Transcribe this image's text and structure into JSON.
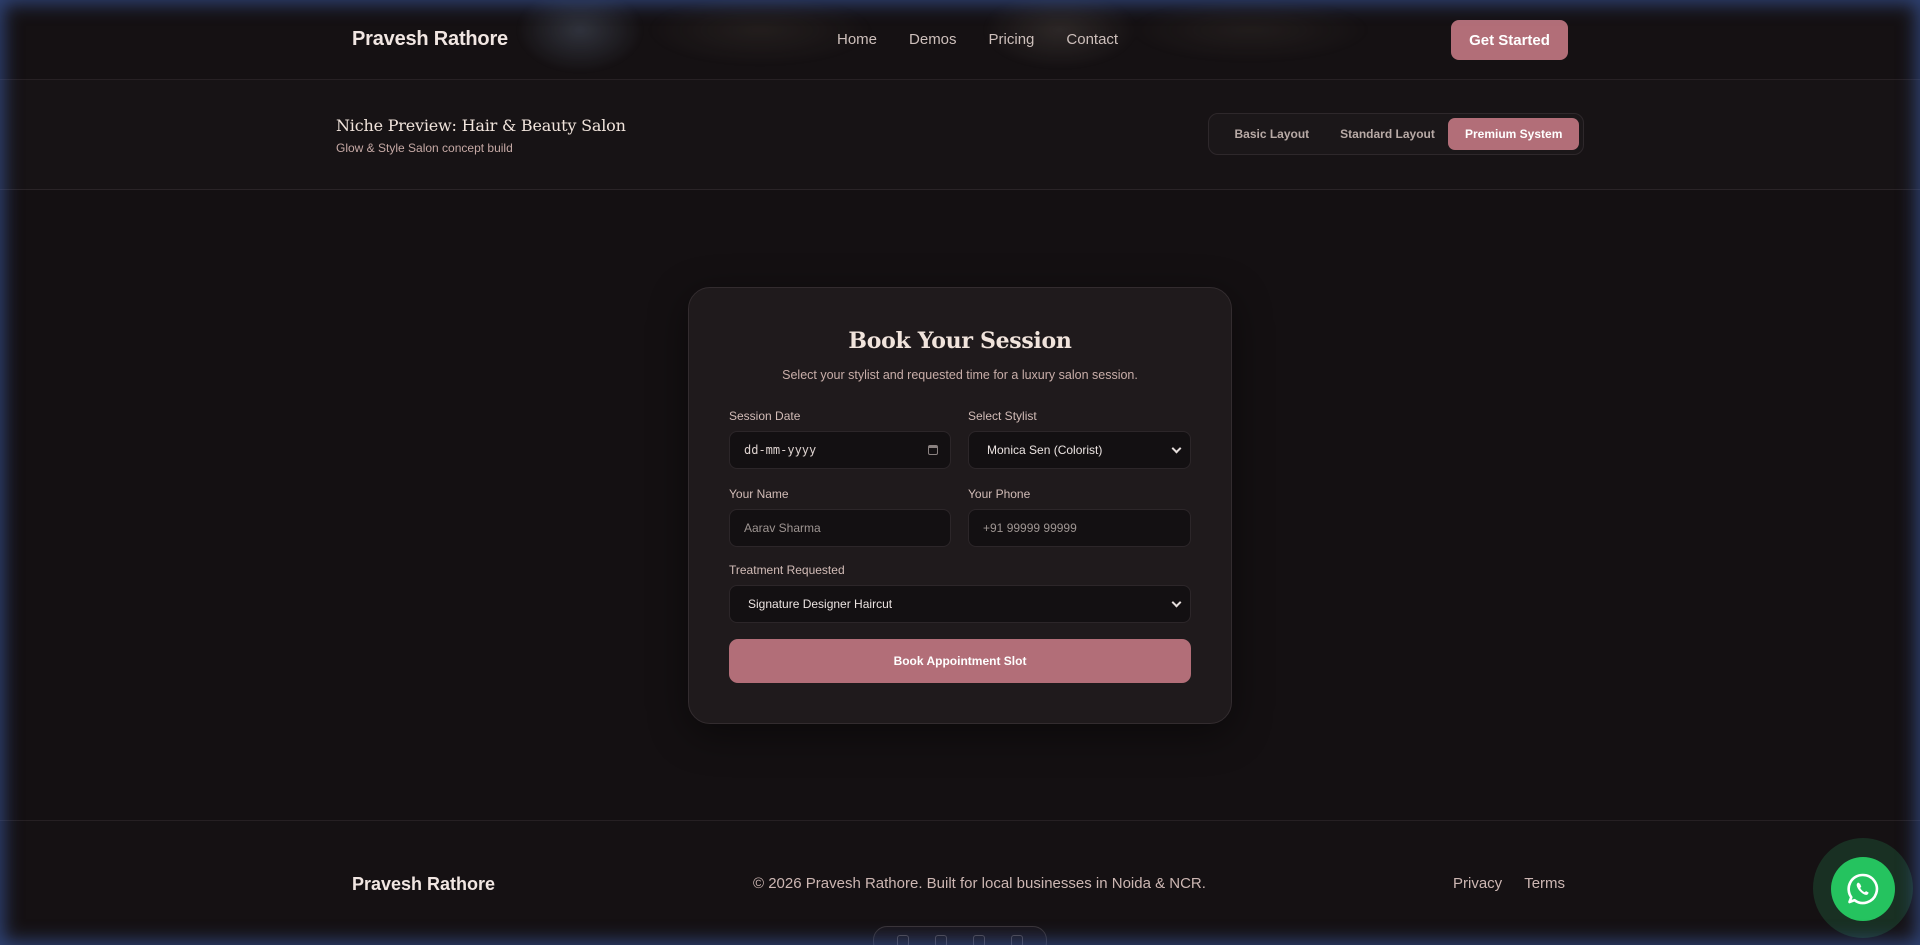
{
  "header": {
    "brand": "Pravesh Rathore",
    "nav": [
      "Home",
      "Demos",
      "Pricing",
      "Contact"
    ],
    "cta_label": "Get Started"
  },
  "preview": {
    "title": "Niche Preview: Hair & Beauty Salon",
    "subtitle": "Glow & Style Salon concept build",
    "layouts": [
      "Basic Layout",
      "Standard Layout",
      "Premium System"
    ],
    "active_layout": "Premium System"
  },
  "booking": {
    "title": "Book Your Session",
    "subtitle": "Select your stylist and requested time for a luxury salon session.",
    "session_date": {
      "label": "Session Date",
      "placeholder": "dd-mm-yyyy"
    },
    "stylist": {
      "label": "Select Stylist",
      "value": "Monica Sen (Colorist)"
    },
    "name": {
      "label": "Your Name",
      "placeholder": "Aarav Sharma"
    },
    "phone": {
      "label": "Your Phone",
      "placeholder": "+91 99999 99999"
    },
    "treatment": {
      "label": "Treatment Requested",
      "value": "Signature Designer Haircut"
    },
    "submit_label": "Book Appointment Slot"
  },
  "footer": {
    "brand": "Pravesh Rathore",
    "copyright": "© 2026 Pravesh Rathore. Built for local businesses in Noida & NCR.",
    "links": [
      "Privacy",
      "Terms"
    ]
  },
  "colors": {
    "background": "#141012",
    "accent": "#b26e78",
    "card": "#1f1a1c",
    "whatsapp": "#25c35f"
  },
  "icons": {
    "floating_button": "whatsapp-icon",
    "date_picker": "calendar-icon",
    "select": "chevron-down-icon"
  }
}
